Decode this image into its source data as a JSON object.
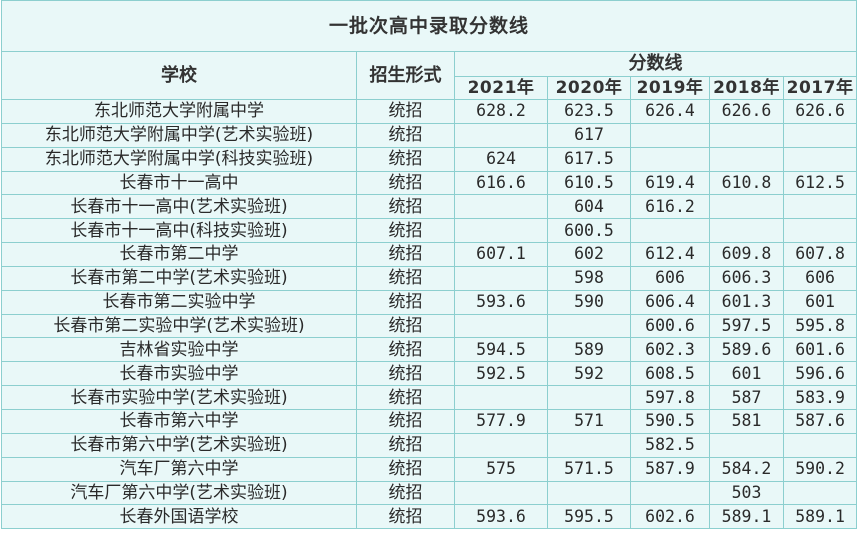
{
  "title": "一批次高中录取分数线",
  "headers": {
    "school": "学校",
    "type": "招生形式",
    "score_group": "分数线",
    "years": [
      "2021年",
      "2020年",
      "2019年",
      "2018年",
      "2017年"
    ]
  },
  "rows": [
    {
      "school": "东北师范大学附属中学",
      "type": "统招",
      "scores": [
        "628.2",
        "623.5",
        "626.4",
        "626.6",
        "626.6"
      ]
    },
    {
      "school": "东北师范大学附属中学(艺术实验班)",
      "type": "统招",
      "scores": [
        "",
        "617",
        "",
        "",
        ""
      ]
    },
    {
      "school": "东北师范大学附属中学(科技实验班)",
      "type": "统招",
      "scores": [
        "624",
        "617.5",
        "",
        "",
        ""
      ]
    },
    {
      "school": "长春市十一高中",
      "type": "统招",
      "scores": [
        "616.6",
        "610.5",
        "619.4",
        "610.8",
        "612.5"
      ]
    },
    {
      "school": "长春市十一高中(艺术实验班)",
      "type": "统招",
      "scores": [
        "",
        "604",
        "616.2",
        "",
        ""
      ]
    },
    {
      "school": "长春市十一高中(科技实验班)",
      "type": "统招",
      "scores": [
        "",
        "600.5",
        "",
        "",
        ""
      ]
    },
    {
      "school": "长春市第二中学",
      "type": "统招",
      "scores": [
        "607.1",
        "602",
        "612.4",
        "609.8",
        "607.8"
      ]
    },
    {
      "school": "长春市第二中学(艺术实验班)",
      "type": "统招",
      "scores": [
        "",
        "598",
        "606",
        "606.3",
        "606"
      ]
    },
    {
      "school": "长春市第二实验中学",
      "type": "统招",
      "scores": [
        "593.6",
        "590",
        "606.4",
        "601.3",
        "601"
      ]
    },
    {
      "school": "长春市第二实验中学(艺术实验班)",
      "type": "统招",
      "scores": [
        "",
        "",
        "600.6",
        "597.5",
        "595.8"
      ]
    },
    {
      "school": "吉林省实验中学",
      "type": "统招",
      "scores": [
        "594.5",
        "589",
        "602.3",
        "589.6",
        "601.6"
      ]
    },
    {
      "school": "长春市实验中学",
      "type": "统招",
      "scores": [
        "592.5",
        "592",
        "608.5",
        "601",
        "596.6"
      ]
    },
    {
      "school": "长春市实验中学(艺术实验班)",
      "type": "统招",
      "scores": [
        "",
        "",
        "597.8",
        "587",
        "583.9"
      ]
    },
    {
      "school": "长春市第六中学",
      "type": "统招",
      "scores": [
        "577.9",
        "571",
        "590.5",
        "581",
        "587.6"
      ]
    },
    {
      "school": "长春市第六中学(艺术实验班)",
      "type": "统招",
      "scores": [
        "",
        "",
        "582.5",
        "",
        ""
      ]
    },
    {
      "school": "汽车厂第六中学",
      "type": "统招",
      "scores": [
        "575",
        "571.5",
        "587.9",
        "584.2",
        "590.2"
      ]
    },
    {
      "school": "汽车厂第六中学(艺术实验班)",
      "type": "统招",
      "scores": [
        "",
        "",
        "",
        "503",
        ""
      ]
    },
    {
      "school": "长春外国语学校",
      "type": "统招",
      "scores": [
        "593.6",
        "595.5",
        "602.6",
        "589.1",
        "589.1"
      ]
    }
  ]
}
